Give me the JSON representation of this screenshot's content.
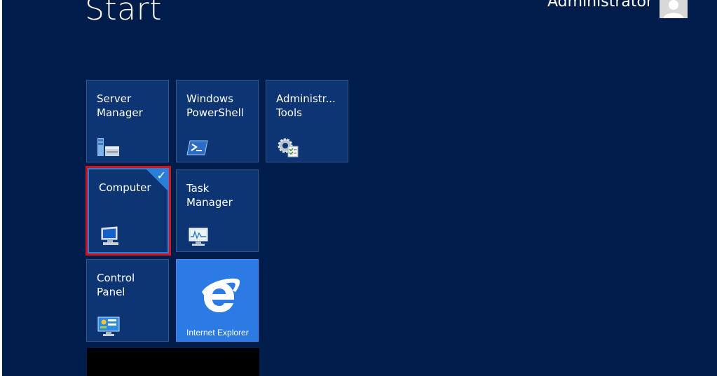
{
  "start": {
    "title": "Start"
  },
  "user": {
    "name": "Administrator"
  },
  "tiles": [
    {
      "label": "Server\nManager",
      "icon": "server-manager-icon"
    },
    {
      "label": "Windows\nPowerShell",
      "icon": "powershell-icon"
    },
    {
      "label": "Administr...\nTools",
      "icon": "admin-tools-icon"
    },
    {
      "label": "Computer",
      "icon": "computer-icon",
      "selected": true
    },
    {
      "label": "Task\nManager",
      "icon": "task-manager-icon"
    },
    {
      "label": "Control\nPanel",
      "icon": "control-panel-icon"
    },
    {
      "label": "Internet Explorer",
      "icon": "internet-explorer-icon"
    }
  ],
  "colors": {
    "background": "#001c4a",
    "tile": "#0d3573",
    "ie_tile": "#2c7be4",
    "selection_outline": "#d4131b",
    "selection_accent": "#2b7fd9"
  }
}
